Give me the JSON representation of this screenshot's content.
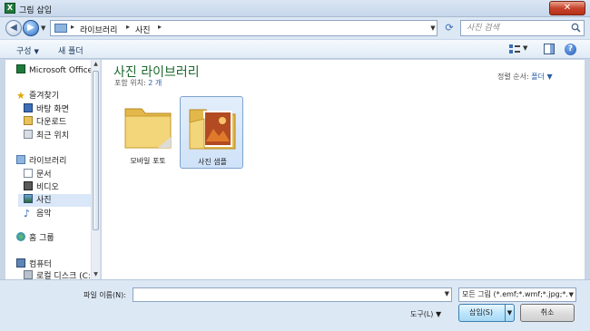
{
  "window": {
    "title": "그림 삽입",
    "close_label": "✕"
  },
  "address": {
    "crumbs": [
      "라이브러리",
      "사진"
    ],
    "search_placeholder": "사진 검색"
  },
  "toolbar": {
    "organize": "구성",
    "new_folder": "새 폴더"
  },
  "sidebar": {
    "items": [
      {
        "label": "Microsoft Office Ex",
        "icon": "excel-icon"
      },
      {
        "label": "즐겨찾기",
        "icon": "star-icon"
      },
      {
        "label": "바탕 화면",
        "icon": "desktop-icon"
      },
      {
        "label": "다운로드",
        "icon": "download-icon"
      },
      {
        "label": "최근 위치",
        "icon": "recent-places-icon"
      },
      {
        "label": "라이브러리",
        "icon": "library-icon"
      },
      {
        "label": "문서",
        "icon": "documents-icon"
      },
      {
        "label": "비디오",
        "icon": "video-icon"
      },
      {
        "label": "사진",
        "icon": "pictures-icon"
      },
      {
        "label": "음악",
        "icon": "music-icon"
      },
      {
        "label": "홈 그룹",
        "icon": "homegroup-icon"
      },
      {
        "label": "컴퓨터",
        "icon": "computer-icon"
      },
      {
        "label": "로컬 디스크 (C:)",
        "icon": "drive-icon"
      }
    ]
  },
  "content": {
    "title": "사진 라이브러리",
    "subtitle_prefix": "포함 위치:",
    "subtitle_count": "2 개",
    "sort_label": "정렬 순서:",
    "sort_value": "폴더",
    "folders": [
      {
        "label": "모바일 포토"
      },
      {
        "label": "사진 샘플"
      }
    ]
  },
  "footer": {
    "filename_label": "파일 이름(N):",
    "filename_value": "",
    "filter_value": "모든 그림 (*.emf;*.wmf;*.jpg;*.",
    "tools_label": "도구(L)",
    "insert_label": "삽입(S)",
    "cancel_label": "취소"
  },
  "colors": {
    "accent_title": "#1c6a2e",
    "link_blue": "#2b5fa5",
    "selection": "#d9e7f8"
  }
}
